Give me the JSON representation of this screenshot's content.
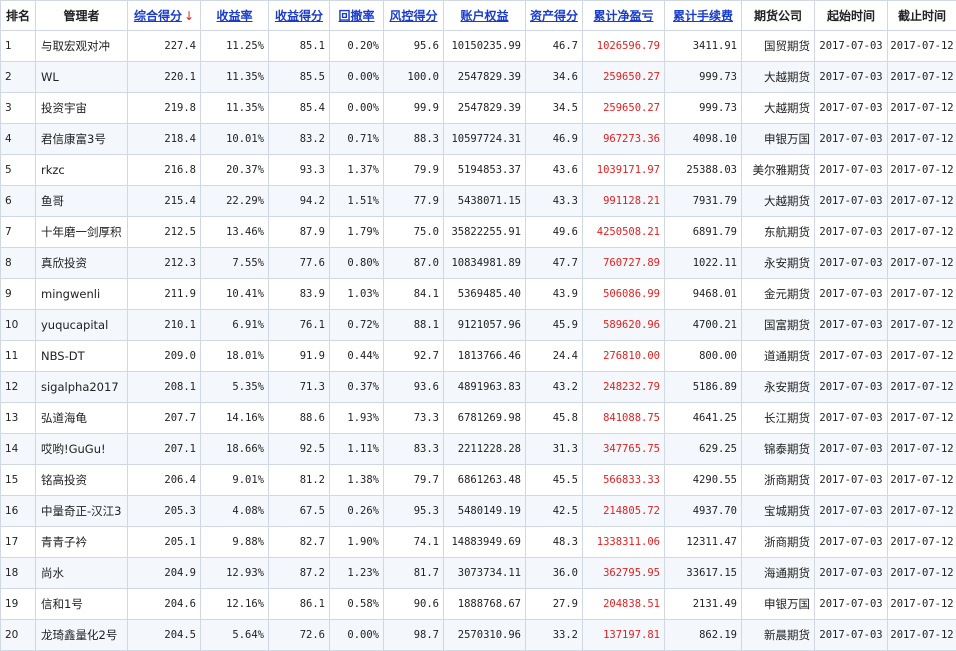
{
  "table": {
    "headers": {
      "rank": "排名",
      "manager": "管理者",
      "total_score": "综合得分",
      "sort_indicator": "↓",
      "return_rate": "收益率",
      "return_score": "收益得分",
      "drawdown": "回撤率",
      "risk_score": "风控得分",
      "equity": "账户权益",
      "asset_score": "资产得分",
      "net_profit": "累计净盈亏",
      "fees": "累计手续费",
      "company": "期货公司",
      "start": "起始时间",
      "end": "截止时间"
    },
    "rows": [
      {
        "rank": "1",
        "manager": "与取宏观对冲",
        "total_score": "227.4",
        "return_rate": "11.25%",
        "return_score": "85.1",
        "drawdown": "0.20%",
        "risk_score": "95.6",
        "equity": "10150235.99",
        "asset_score": "46.7",
        "net_profit": "1026596.79",
        "fees": "3411.91",
        "company": "国贸期货",
        "start": "2017-07-03",
        "end": "2017-07-12"
      },
      {
        "rank": "2",
        "manager": "WL",
        "total_score": "220.1",
        "return_rate": "11.35%",
        "return_score": "85.5",
        "drawdown": "0.00%",
        "risk_score": "100.0",
        "equity": "2547829.39",
        "asset_score": "34.6",
        "net_profit": "259650.27",
        "fees": "999.73",
        "company": "大越期货",
        "start": "2017-07-03",
        "end": "2017-07-12"
      },
      {
        "rank": "3",
        "manager": "投资宇宙",
        "total_score": "219.8",
        "return_rate": "11.35%",
        "return_score": "85.4",
        "drawdown": "0.00%",
        "risk_score": "99.9",
        "equity": "2547829.39",
        "asset_score": "34.5",
        "net_profit": "259650.27",
        "fees": "999.73",
        "company": "大越期货",
        "start": "2017-07-03",
        "end": "2017-07-12"
      },
      {
        "rank": "4",
        "manager": "君信康富3号",
        "total_score": "218.4",
        "return_rate": "10.01%",
        "return_score": "83.2",
        "drawdown": "0.71%",
        "risk_score": "88.3",
        "equity": "10597724.31",
        "asset_score": "46.9",
        "net_profit": "967273.36",
        "fees": "4098.10",
        "company": "申银万国",
        "start": "2017-07-03",
        "end": "2017-07-12"
      },
      {
        "rank": "5",
        "manager": "rkzc",
        "total_score": "216.8",
        "return_rate": "20.37%",
        "return_score": "93.3",
        "drawdown": "1.37%",
        "risk_score": "79.9",
        "equity": "5194853.37",
        "asset_score": "43.6",
        "net_profit": "1039171.97",
        "fees": "25388.03",
        "company": "美尔雅期货",
        "start": "2017-07-03",
        "end": "2017-07-12"
      },
      {
        "rank": "6",
        "manager": "鱼哥",
        "total_score": "215.4",
        "return_rate": "22.29%",
        "return_score": "94.2",
        "drawdown": "1.51%",
        "risk_score": "77.9",
        "equity": "5438071.15",
        "asset_score": "43.3",
        "net_profit": "991128.21",
        "fees": "7931.79",
        "company": "大越期货",
        "start": "2017-07-03",
        "end": "2017-07-12"
      },
      {
        "rank": "7",
        "manager": "十年磨一剑厚积",
        "total_score": "212.5",
        "return_rate": "13.46%",
        "return_score": "87.9",
        "drawdown": "1.79%",
        "risk_score": "75.0",
        "equity": "35822255.91",
        "asset_score": "49.6",
        "net_profit": "4250508.21",
        "fees": "6891.79",
        "company": "东航期货",
        "start": "2017-07-03",
        "end": "2017-07-12"
      },
      {
        "rank": "8",
        "manager": "真欣投资",
        "total_score": "212.3",
        "return_rate": "7.55%",
        "return_score": "77.6",
        "drawdown": "0.80%",
        "risk_score": "87.0",
        "equity": "10834981.89",
        "asset_score": "47.7",
        "net_profit": "760727.89",
        "fees": "1022.11",
        "company": "永安期货",
        "start": "2017-07-03",
        "end": "2017-07-12"
      },
      {
        "rank": "9",
        "manager": "mingwenli",
        "total_score": "211.9",
        "return_rate": "10.41%",
        "return_score": "83.9",
        "drawdown": "1.03%",
        "risk_score": "84.1",
        "equity": "5369485.40",
        "asset_score": "43.9",
        "net_profit": "506086.99",
        "fees": "9468.01",
        "company": "金元期货",
        "start": "2017-07-03",
        "end": "2017-07-12"
      },
      {
        "rank": "10",
        "manager": "yuqucapital",
        "total_score": "210.1",
        "return_rate": "6.91%",
        "return_score": "76.1",
        "drawdown": "0.72%",
        "risk_score": "88.1",
        "equity": "9121057.96",
        "asset_score": "45.9",
        "net_profit": "589620.96",
        "fees": "4700.21",
        "company": "国富期货",
        "start": "2017-07-03",
        "end": "2017-07-12"
      },
      {
        "rank": "11",
        "manager": "NBS-DT",
        "total_score": "209.0",
        "return_rate": "18.01%",
        "return_score": "91.9",
        "drawdown": "0.44%",
        "risk_score": "92.7",
        "equity": "1813766.46",
        "asset_score": "24.4",
        "net_profit": "276810.00",
        "fees": "800.00",
        "company": "道通期货",
        "start": "2017-07-03",
        "end": "2017-07-12"
      },
      {
        "rank": "12",
        "manager": "sigalpha2017",
        "total_score": "208.1",
        "return_rate": "5.35%",
        "return_score": "71.3",
        "drawdown": "0.37%",
        "risk_score": "93.6",
        "equity": "4891963.83",
        "asset_score": "43.2",
        "net_profit": "248232.79",
        "fees": "5186.89",
        "company": "永安期货",
        "start": "2017-07-03",
        "end": "2017-07-12"
      },
      {
        "rank": "13",
        "manager": "弘道海龟",
        "total_score": "207.7",
        "return_rate": "14.16%",
        "return_score": "88.6",
        "drawdown": "1.93%",
        "risk_score": "73.3",
        "equity": "6781269.98",
        "asset_score": "45.8",
        "net_profit": "841088.75",
        "fees": "4641.25",
        "company": "长江期货",
        "start": "2017-07-03",
        "end": "2017-07-12"
      },
      {
        "rank": "14",
        "manager": "哎哟!GuGu!",
        "total_score": "207.1",
        "return_rate": "18.66%",
        "return_score": "92.5",
        "drawdown": "1.11%",
        "risk_score": "83.3",
        "equity": "2211228.28",
        "asset_score": "31.3",
        "net_profit": "347765.75",
        "fees": "629.25",
        "company": "锦泰期货",
        "start": "2017-07-03",
        "end": "2017-07-12"
      },
      {
        "rank": "15",
        "manager": "铭高投资",
        "total_score": "206.4",
        "return_rate": "9.01%",
        "return_score": "81.2",
        "drawdown": "1.38%",
        "risk_score": "79.7",
        "equity": "6861263.48",
        "asset_score": "45.5",
        "net_profit": "566833.33",
        "fees": "4290.55",
        "company": "浙商期货",
        "start": "2017-07-03",
        "end": "2017-07-12"
      },
      {
        "rank": "16",
        "manager": "中量奇正-汉江3",
        "total_score": "205.3",
        "return_rate": "4.08%",
        "return_score": "67.5",
        "drawdown": "0.26%",
        "risk_score": "95.3",
        "equity": "5480149.19",
        "asset_score": "42.5",
        "net_profit": "214805.72",
        "fees": "4937.70",
        "company": "宝城期货",
        "start": "2017-07-03",
        "end": "2017-07-12"
      },
      {
        "rank": "17",
        "manager": "青青子衿",
        "total_score": "205.1",
        "return_rate": "9.88%",
        "return_score": "82.7",
        "drawdown": "1.90%",
        "risk_score": "74.1",
        "equity": "14883949.69",
        "asset_score": "48.3",
        "net_profit": "1338311.06",
        "fees": "12311.47",
        "company": "浙商期货",
        "start": "2017-07-03",
        "end": "2017-07-12"
      },
      {
        "rank": "18",
        "manager": "尚水",
        "total_score": "204.9",
        "return_rate": "12.93%",
        "return_score": "87.2",
        "drawdown": "1.23%",
        "risk_score": "81.7",
        "equity": "3073734.11",
        "asset_score": "36.0",
        "net_profit": "362795.95",
        "fees": "33617.15",
        "company": "海通期货",
        "start": "2017-07-03",
        "end": "2017-07-12"
      },
      {
        "rank": "19",
        "manager": "信和1号",
        "total_score": "204.6",
        "return_rate": "12.16%",
        "return_score": "86.1",
        "drawdown": "0.58%",
        "risk_score": "90.6",
        "equity": "1888768.67",
        "asset_score": "27.9",
        "net_profit": "204838.51",
        "fees": "2131.49",
        "company": "申银万国",
        "start": "2017-07-03",
        "end": "2017-07-12"
      },
      {
        "rank": "20",
        "manager": "龙琦鑫量化2号",
        "total_score": "204.5",
        "return_rate": "5.64%",
        "return_score": "72.6",
        "drawdown": "0.00%",
        "risk_score": "98.7",
        "equity": "2570310.96",
        "asset_score": "33.2",
        "net_profit": "137197.81",
        "fees": "862.19",
        "company": "新晨期货",
        "start": "2017-07-03",
        "end": "2017-07-12"
      }
    ]
  }
}
